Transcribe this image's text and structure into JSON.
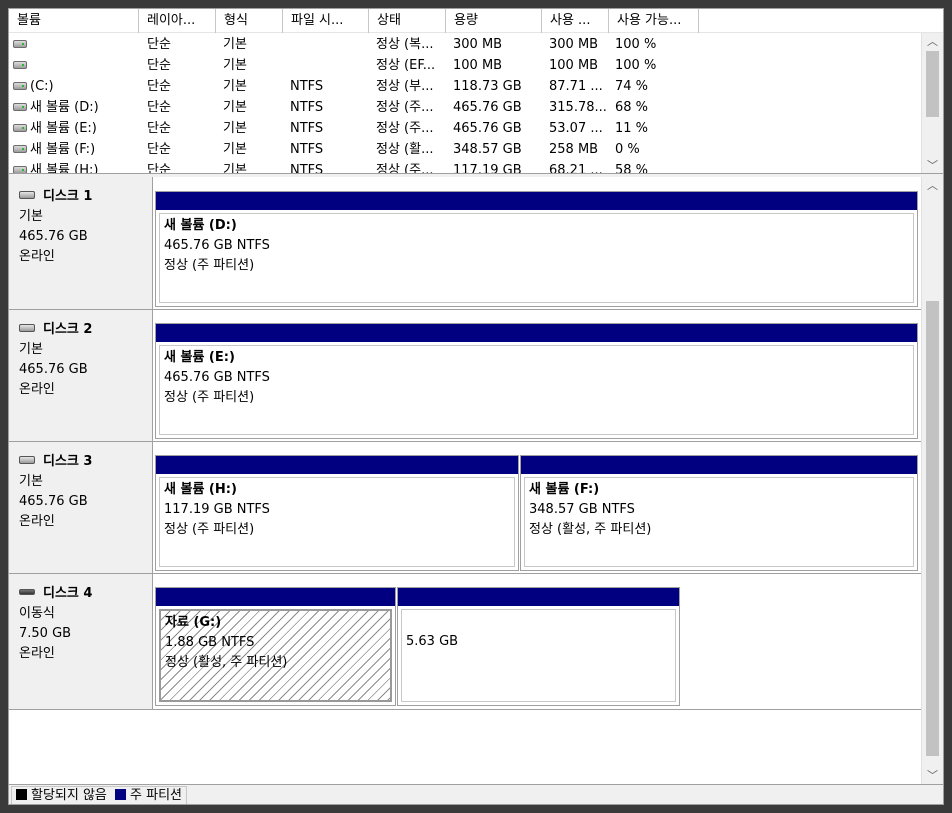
{
  "volume_list": {
    "columns": [
      "볼륨",
      "레이아...",
      "형식",
      "파일 시...",
      "상태",
      "용량",
      "사용 ...",
      "사용 가능..."
    ],
    "rows": [
      {
        "volume": "",
        "layout": "단순",
        "type": "기본",
        "fs": "",
        "status": "정상 (복...",
        "capacity": "300 MB",
        "used": "300 MB",
        "free": "100 %"
      },
      {
        "volume": "",
        "layout": "단순",
        "type": "기본",
        "fs": "",
        "status": "정상 (EF...",
        "capacity": "100 MB",
        "used": "100 MB",
        "free": "100 %"
      },
      {
        "volume": "(C:)",
        "layout": "단순",
        "type": "기본",
        "fs": "NTFS",
        "status": "정상 (부...",
        "capacity": "118.73 GB",
        "used": "87.71 ...",
        "free": "74 %"
      },
      {
        "volume": "새 볼륨 (D:)",
        "layout": "단순",
        "type": "기본",
        "fs": "NTFS",
        "status": "정상 (주...",
        "capacity": "465.76 GB",
        "used": "315.78...",
        "free": "68 %"
      },
      {
        "volume": "새 볼륨 (E:)",
        "layout": "단순",
        "type": "기본",
        "fs": "NTFS",
        "status": "정상 (주...",
        "capacity": "465.76 GB",
        "used": "53.07 ...",
        "free": "11 %"
      },
      {
        "volume": "새 볼륨 (F:)",
        "layout": "단순",
        "type": "기본",
        "fs": "NTFS",
        "status": "정상 (활...",
        "capacity": "348.57 GB",
        "used": "258 MB",
        "free": "0 %"
      },
      {
        "volume": "새 볼륨 (H:)",
        "layout": "단순",
        "type": "기본",
        "fs": "NTFS",
        "status": "정상 (주...",
        "capacity": "117.19 GB",
        "used": "68.21 ...",
        "free": "58 %"
      }
    ]
  },
  "disks": [
    {
      "name": "디스크 1",
      "kind": "기본",
      "size": "465.76 GB",
      "state": "온라인",
      "partitions": [
        {
          "title": "새 볼륨  (D:)",
          "size_fs": "465.76 GB NTFS",
          "status": "정상 (주 파티션)"
        }
      ]
    },
    {
      "name": "디스크 2",
      "kind": "기본",
      "size": "465.76 GB",
      "state": "온라인",
      "partitions": [
        {
          "title": "새 볼륨  (E:)",
          "size_fs": "465.76 GB NTFS",
          "status": "정상 (주 파티션)"
        }
      ]
    },
    {
      "name": "디스크 3",
      "kind": "기본",
      "size": "465.76 GB",
      "state": "온라인",
      "partitions": [
        {
          "title": "새 볼륨  (H:)",
          "size_fs": "117.19 GB NTFS",
          "status": "정상 (주 파티션)"
        },
        {
          "title": "새 볼륨  (F:)",
          "size_fs": "348.57 GB NTFS",
          "status": "정상 (활성, 주 파티션)"
        }
      ]
    },
    {
      "name": "디스크 4",
      "kind": "이동식",
      "size": "7.50 GB",
      "state": "온라인",
      "partitions": [
        {
          "title": "자료  (G:)",
          "size_fs": "1.88 GB NTFS",
          "status": "정상 (활성, 주 파티션)",
          "selected": true
        },
        {
          "title": "",
          "size_fs": "5.63 GB",
          "status": ""
        }
      ]
    }
  ],
  "legend": {
    "unallocated": "할당되지 않음",
    "primary": "주 파티션"
  },
  "colors": {
    "partition_bar": "#000080",
    "unallocated": "#000000",
    "window_bg": "#f0f0f0"
  },
  "icons": {
    "volume": "volume-drive-icon",
    "disk": "hard-disk-icon",
    "removable": "removable-disk-icon",
    "scroll_up": "scroll-up-arrow-icon",
    "scroll_down": "scroll-down-arrow-icon"
  }
}
